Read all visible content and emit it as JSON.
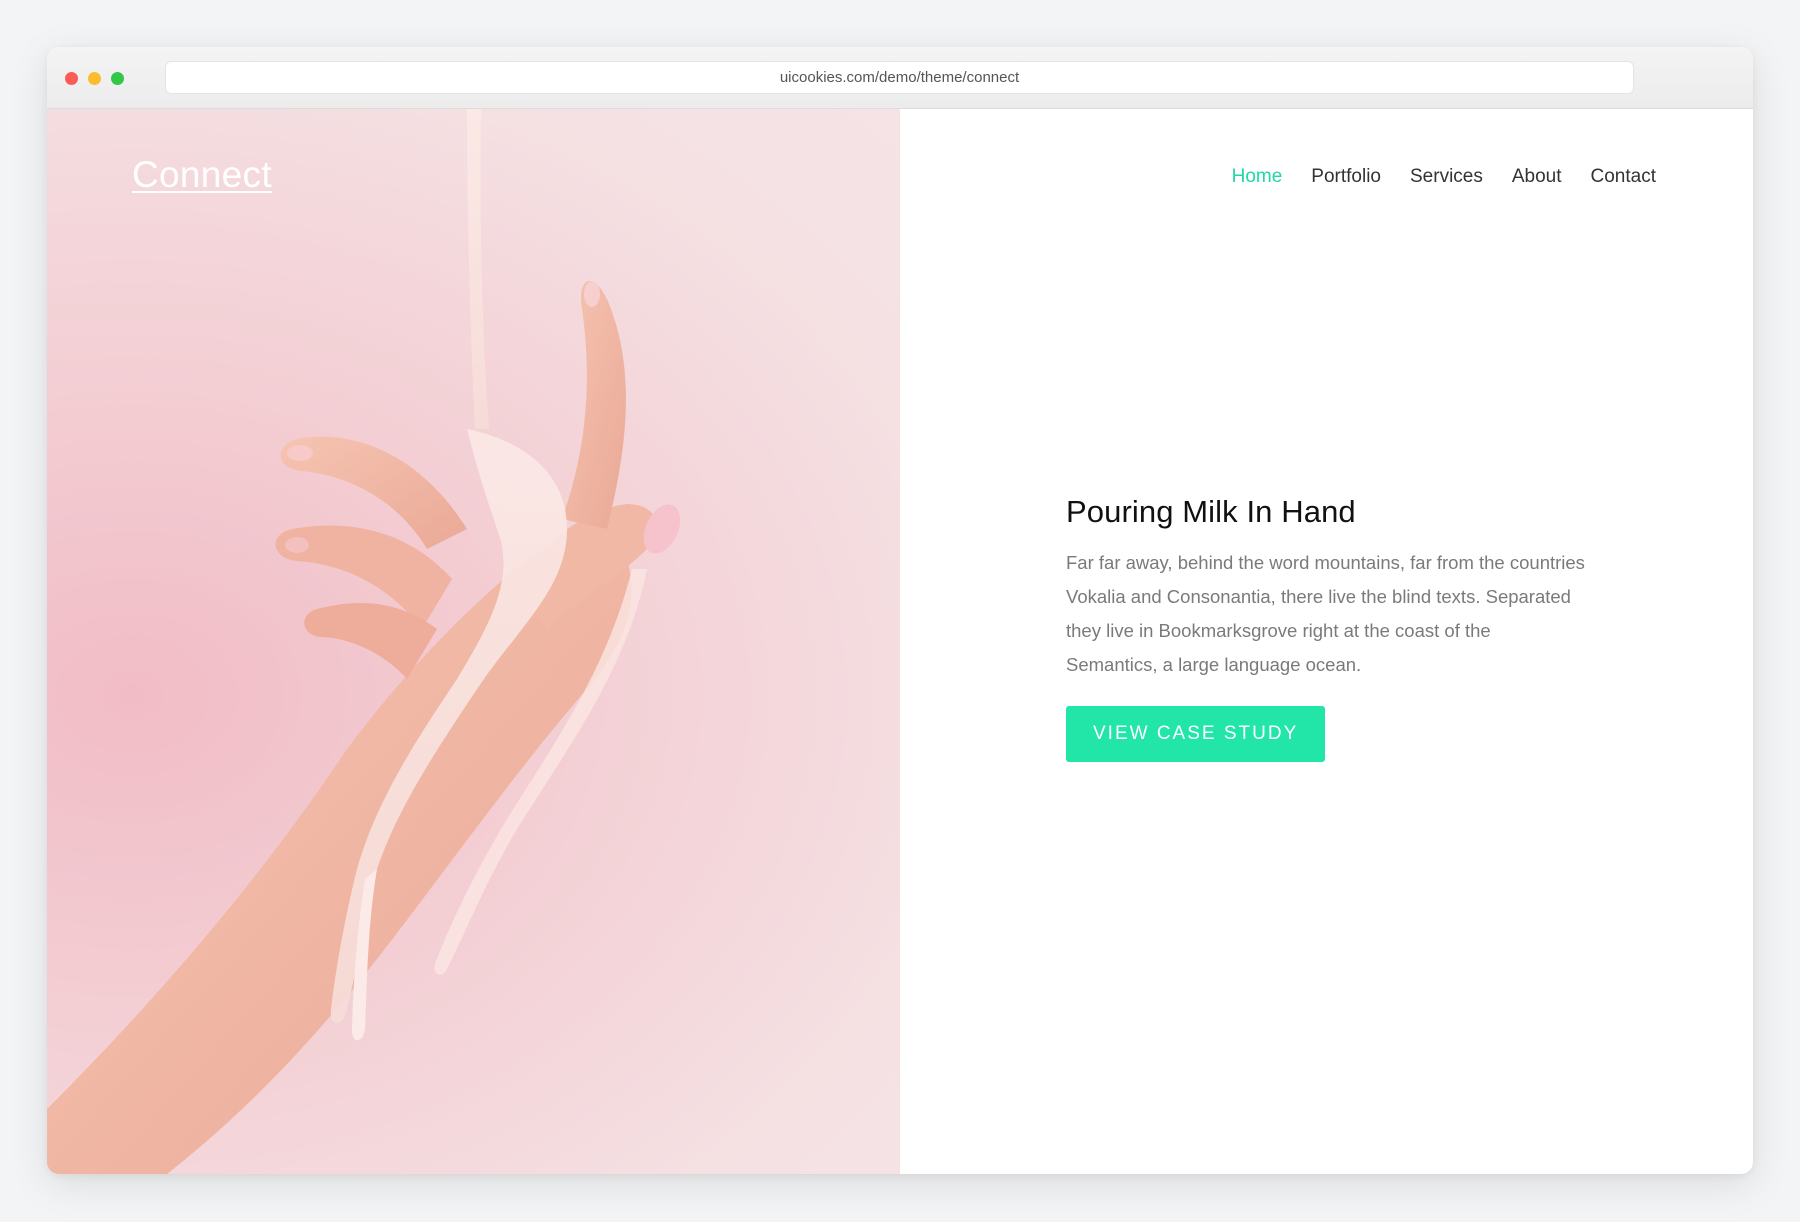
{
  "browser": {
    "url": "uicookies.com/demo/theme/connect"
  },
  "site": {
    "logo": "Connect"
  },
  "nav": {
    "items": [
      {
        "label": "Home",
        "active": true
      },
      {
        "label": "Portfolio",
        "active": false
      },
      {
        "label": "Services",
        "active": false
      },
      {
        "label": "About",
        "active": false
      },
      {
        "label": "Contact",
        "active": false
      }
    ]
  },
  "hero": {
    "title": "Pouring Milk In Hand",
    "body": "Far far away, behind the word mountains, far from the countries Vokalia and Consonantia, there live the blind texts. Separated they live in Bookmarksgrove right at the coast of the Semantics, a large language ocean.",
    "cta_label": "VIEW CASE STUDY",
    "image_subject": "hand-with-pouring-milk"
  },
  "colors": {
    "accent": "#21e6a8",
    "nav_active": "#1fd8a3",
    "image_bg": "#f5e1e3"
  }
}
